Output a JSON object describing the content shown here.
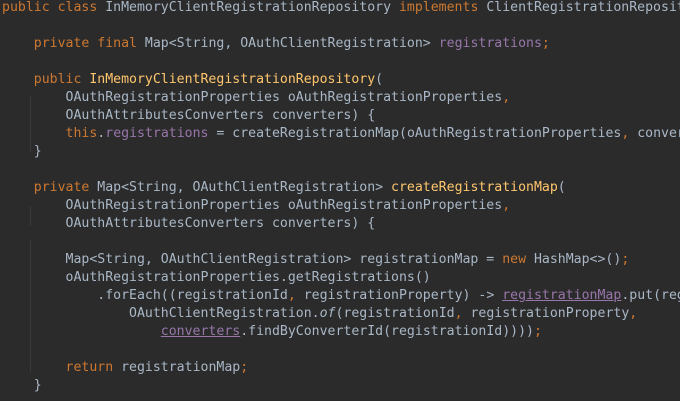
{
  "code": {
    "l1": {
      "t1": "public class ",
      "t2": "InMemoryClientRegistrationRepository ",
      "t3": "implements ",
      "t4": "ClientRegistrationRepository {"
    },
    "l2": {
      "t1": "    private final ",
      "t2": "Map<String, OAuthClientRegistration> ",
      "t3": "registrations",
      "t4": ";"
    },
    "l3": {
      "t1": "    public ",
      "t2": "InMemoryClientRegistrationRepository",
      "t3": "("
    },
    "l4": {
      "t1": "        OAuthRegistrationProperties oAuthRegistrationProperties",
      "t2": ","
    },
    "l5": {
      "t1": "        OAuthAttributesConverters converters) {"
    },
    "l6": {
      "t1": "        ",
      "t2": "this",
      "t3": ".",
      "t4": "registrations",
      "t5": " = createRegistrationMap(oAuthRegistrationProperties",
      "t6": ", ",
      "t7": "converters)",
      "t8": ";"
    },
    "l7": {
      "t1": "    }"
    },
    "l8": {
      "t1": "    private ",
      "t2": "Map<String, OAuthClientRegistration> ",
      "t3": "createRegistrationMap",
      "t4": "("
    },
    "l9": {
      "t1": "        OAuthRegistrationProperties oAuthRegistrationProperties",
      "t2": ","
    },
    "l10": {
      "t1": "        OAuthAttributesConverters converters) {"
    },
    "l11": {
      "t1": "        Map<String, OAuthClientRegistration> registrationMap = ",
      "t2": "new ",
      "t3": "HashMap<>()",
      "t4": ";"
    },
    "l12": {
      "t1": "        oAuthRegistrationProperties.getRegistrations()"
    },
    "l13": {
      "t1": "            .forEach((registrationId",
      "t2": ", ",
      "t3": "registrationProperty) -> ",
      "t4": "registrationMap",
      "t5": ".put(registrationId",
      "t6": ","
    },
    "l14": {
      "t1": "                OAuthClientRegistration.",
      "t2": "of",
      "t3": "(registrationId",
      "t4": ", ",
      "t5": "registrationProperty",
      "t6": ","
    },
    "l15": {
      "t1": "                    ",
      "t2": "converters",
      "t3": ".findByConverterId(registrationId))))",
      "t4": ";"
    },
    "l16": {
      "t1": "        ",
      "t2": "return ",
      "t3": "registrationMap",
      "t4": ";"
    },
    "l17": {
      "t1": "    }"
    }
  },
  "colors": {
    "background": "#2b2b2b",
    "default_text": "#a9b7c6",
    "keyword": "#cc7832",
    "method_declaration": "#ffc66d",
    "field": "#9876aa"
  }
}
